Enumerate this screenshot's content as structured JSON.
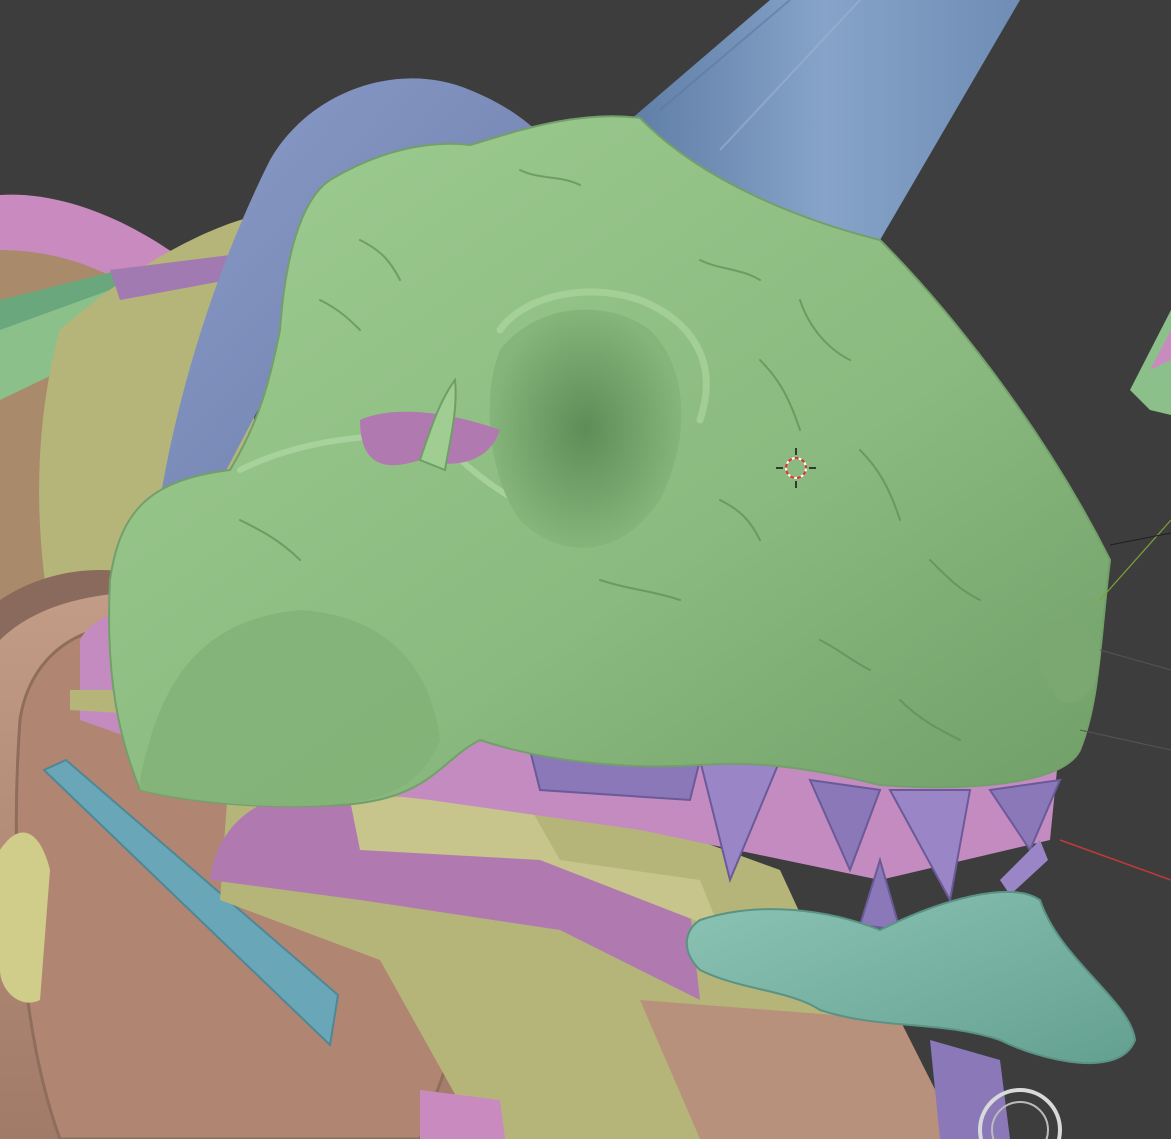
{
  "viewport": {
    "label": "3D Viewport",
    "background": "#3d3d3d",
    "cursor_icon": "3d-cursor-icon",
    "axis_x_color": "#c0393b",
    "axis_y_color": "#7aa33a"
  },
  "materials": {
    "skull": "#8fbf85",
    "horn_tube": "#6f8fb8",
    "back_plate": "#7d8fbe",
    "mouth_interior": "#b07ab0",
    "teeth": "#8a78b8",
    "tongue_jaw": "#79b3a3",
    "armor_tan": "#b8917c",
    "armor_yellow": "#b5b57a",
    "armor_pink": "#c98ac0",
    "trim_blue": "#69a6b8"
  }
}
